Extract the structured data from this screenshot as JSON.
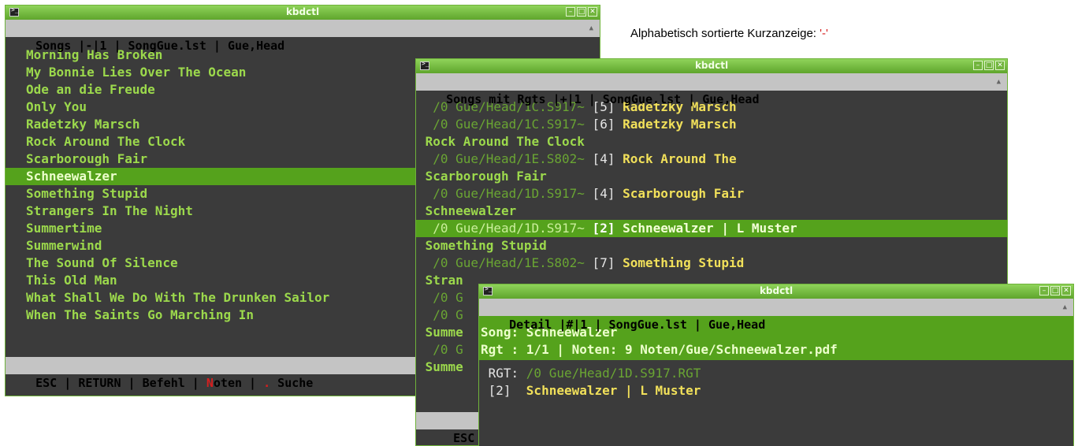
{
  "note": {
    "text": "Alphabetisch sortierte Kurzanzeige:",
    "key": "'-'"
  },
  "win1": {
    "title": "kbdctl",
    "header": "Songs |-|1 | SongGue.lst | Gue,Head",
    "songs": [
      "Morning Has Broken",
      "My Bonnie Lies Over The Ocean",
      "Ode an die Freude",
      "Only You",
      "Radetzky Marsch",
      "Rock Around The Clock",
      "Scarborough Fair",
      "Schneewalzer",
      "Something Stupid",
      "Strangers In The Night",
      "Summertime",
      "Summerwind",
      "The Sound Of Silence",
      "This Old Man",
      "What Shall We Do With The Drunken Sailor",
      "When The Saints Go Marching In"
    ],
    "selected_index": 7,
    "footer": {
      "esc": "ESC",
      "sep": " | ",
      "ret": "RETURN",
      "cmd": "Befehl",
      "noten_key": "N",
      "noten_rest": "oten",
      "dot": ".",
      "search": " Suche"
    }
  },
  "win2": {
    "title": "kbdctl",
    "header": "Songs mit Rgts |+|1 | SongGue.lst | Gue,Head",
    "lines": [
      {
        "kind": "blank"
      },
      {
        "kind": "rgt",
        "path": "  /0 Gue/Head/1C.S917~",
        "num": " [5] ",
        "name": "Radetzky Marsch"
      },
      {
        "kind": "rgt",
        "path": "  /0 Gue/Head/1C.S917~",
        "num": " [6] ",
        "name": "Radetzky Marsch"
      },
      {
        "kind": "song",
        "name": " Rock Around The Clock"
      },
      {
        "kind": "rgt",
        "path": "  /0 Gue/Head/1E.S802~",
        "num": " [4] ",
        "name": "Rock Around The"
      },
      {
        "kind": "song",
        "name": " Scarborough Fair"
      },
      {
        "kind": "rgt",
        "path": "  /0 Gue/Head/1D.S917~",
        "num": " [4] ",
        "name": "Scarborough Fair"
      },
      {
        "kind": "song",
        "name": " Schneewalzer"
      },
      {
        "kind": "rgt-sel",
        "path": "  /0 Gue/Head/1D.S917~",
        "num": " [2] ",
        "name": "Schneewalzer | L Muster"
      },
      {
        "kind": "song",
        "name": " Something Stupid"
      },
      {
        "kind": "rgt",
        "path": "  /0 Gue/Head/1E.S802~",
        "num": " [7] ",
        "name": "Something Stupid"
      },
      {
        "kind": "song",
        "name": " Stran"
      },
      {
        "kind": "rgt",
        "path": "  /0 G",
        "num": "",
        "name": ""
      },
      {
        "kind": "rgt",
        "path": "  /0 G",
        "num": "",
        "name": ""
      },
      {
        "kind": "song",
        "name": " Summe"
      },
      {
        "kind": "rgt",
        "path": "  /0 G",
        "num": "",
        "name": ""
      },
      {
        "kind": "song",
        "name": " Summe"
      }
    ],
    "footer": " ESC |"
  },
  "win3": {
    "title": "kbdctl",
    "header": "Detail |#|1 | SongGue.lst | Gue,Head",
    "song_line": "Song: Schneewalzer",
    "rgt_line": "Rgt : 1/1 | Noten: 9 Noten/Gue/Schneewalzer.pdf",
    "rgt_label": " RGT: ",
    "rgt_path": "/0 Gue/Head/1D.S917.RGT",
    "entry_num": " [2]  ",
    "entry_name": "Schneewalzer | L Muster"
  },
  "colors": {
    "accent": "#55a21c",
    "song_green": "#9cd94c",
    "song_yellow": "#f1e05a",
    "terminal_bg": "#3b3b3b"
  }
}
